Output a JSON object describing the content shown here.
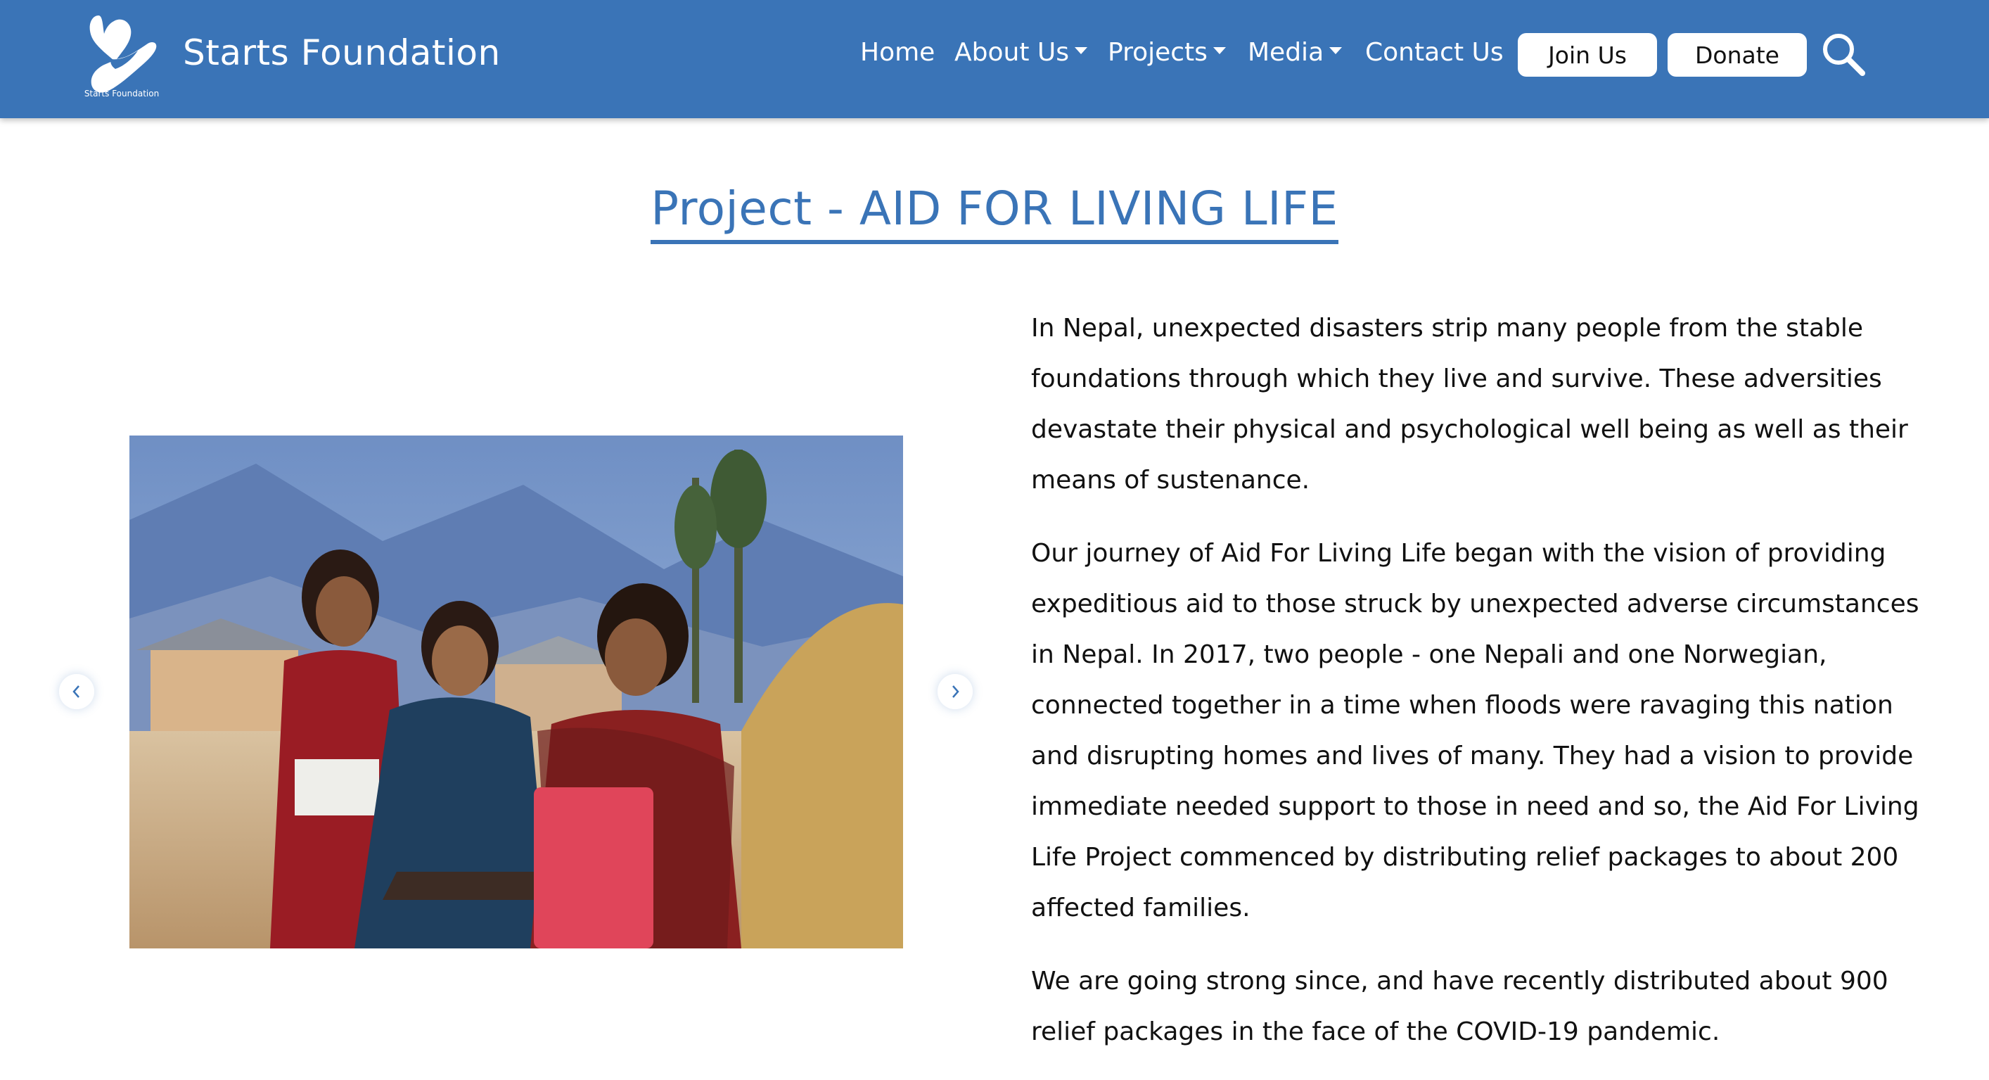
{
  "header": {
    "brand": "Starts Foundation",
    "logo_caption": "Starts Foundation",
    "nav": [
      {
        "label": "Home",
        "dropdown": false
      },
      {
        "label": "About Us",
        "dropdown": true
      },
      {
        "label": "Projects",
        "dropdown": true
      },
      {
        "label": "Media",
        "dropdown": true
      },
      {
        "label": "Contact Us",
        "dropdown": false
      }
    ],
    "join_label": "Join Us",
    "donate_label": "Donate",
    "search_icon": "search-icon"
  },
  "page": {
    "title": "Project - AID FOR LIVING LIFE"
  },
  "carousel": {
    "prev_icon": "chevron-left-icon",
    "next_icon": "chevron-right-icon"
  },
  "content": {
    "paragraphs": [
      "In Nepal, unexpected disasters strip many people from the stable foundations through which they live and survive. These adversities devastate their physical and psychological well being as well as their means of sustenance.",
      "Our journey of Aid For Living Life began with the vision of providing expeditious aid to those struck by unexpected adverse circumstances in Nepal. In 2017, two people - one Nepali and one Norwegian, connected together in a time when floods were ravaging this nation and disrupting homes and lives of many. They had a vision to provide immediate needed support to those in need and so, the Aid For Living Life Project commenced by distributing relief packages to about 200 affected families.",
      "We are going strong since, and have recently distributed about 900 relief packages in the face of the COVID-19 pandemic."
    ]
  },
  "colors": {
    "brand_blue": "#3a74b7",
    "text": "#111111",
    "background": "#ffffff"
  }
}
